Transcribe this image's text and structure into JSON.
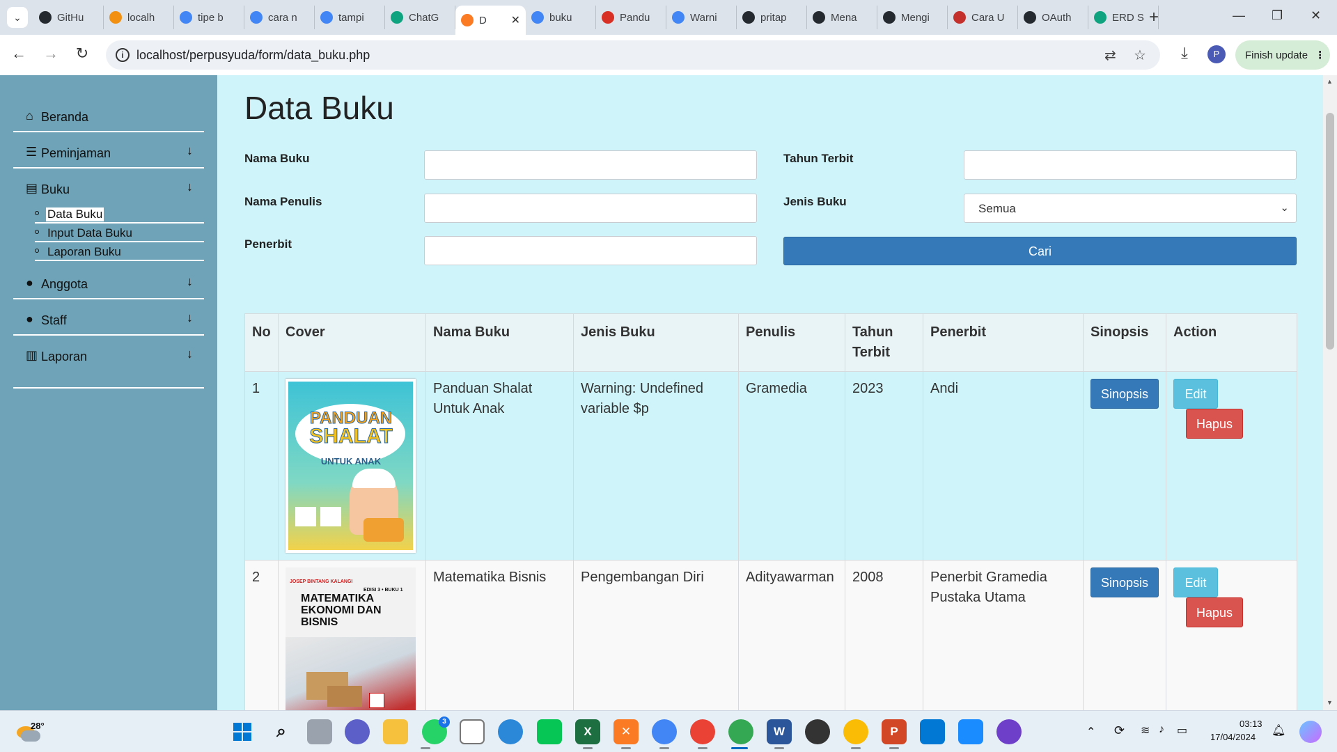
{
  "browser": {
    "tabs": [
      {
        "title": "GitHu",
        "icon": "github-icon",
        "color": "#24292f"
      },
      {
        "title": "localh",
        "icon": "phpmyadmin-icon",
        "color": "#f29111"
      },
      {
        "title": "tipe b",
        "icon": "google-icon",
        "color": "#4285f4"
      },
      {
        "title": "cara n",
        "icon": "google-icon",
        "color": "#4285f4"
      },
      {
        "title": "tampi",
        "icon": "google-icon",
        "color": "#4285f4"
      },
      {
        "title": "ChatG",
        "icon": "chatgpt-icon",
        "color": "#10a37f"
      },
      {
        "title": "D",
        "icon": "xampp-icon",
        "color": "#fb7a24",
        "active": true
      },
      {
        "title": "buku",
        "icon": "google-icon",
        "color": "#4285f4"
      },
      {
        "title": "Pandu",
        "icon": "bookmark-icon",
        "color": "#d93025"
      },
      {
        "title": "Warni",
        "icon": "google-icon",
        "color": "#4285f4"
      },
      {
        "title": "pritap",
        "icon": "github-icon",
        "color": "#24292f"
      },
      {
        "title": "Mena",
        "icon": "github-icon",
        "color": "#24292f"
      },
      {
        "title": "Mengi",
        "icon": "github-icon",
        "color": "#24292f"
      },
      {
        "title": "Cara U",
        "icon": "magnet-icon",
        "color": "#c4302b"
      },
      {
        "title": "OAuth",
        "icon": "github-icon",
        "color": "#24292f"
      },
      {
        "title": "ERD S",
        "icon": "chatgpt-icon",
        "color": "#10a37f"
      }
    ],
    "url": "localhost/perpusyuda/form/data_buku.php",
    "profile_initial": "P",
    "finish_update": "Finish update"
  },
  "sidebar": {
    "items": [
      {
        "label": "Beranda",
        "icon": "home-icon"
      },
      {
        "label": "Peminjaman",
        "icon": "list-icon"
      },
      {
        "label": "Buku",
        "icon": "book-icon"
      },
      {
        "label": "Anggota",
        "icon": "user-icon"
      },
      {
        "label": "Staff",
        "icon": "user-icon"
      },
      {
        "label": "Laporan",
        "icon": "bar-chart-icon"
      }
    ],
    "buku_submenu": [
      "Data Buku",
      "Input Data Buku",
      "Laporan Buku"
    ]
  },
  "page": {
    "title": "Data Buku",
    "form": {
      "nama_buku_label": "Nama Buku",
      "nama_penulis_label": "Nama Penulis",
      "penerbit_label": "Penerbit",
      "tahun_terbit_label": "Tahun Terbit",
      "jenis_buku_label": "Jenis Buku",
      "jenis_buku_value": "Semua",
      "cari_label": "Cari"
    },
    "table": {
      "headers": [
        "No",
        "Cover",
        "Nama Buku",
        "Jenis Buku",
        "Penulis",
        "Tahun Terbit",
        "Penerbit",
        "Sinopsis",
        "Action"
      ],
      "rows": [
        {
          "no": "1",
          "cover_title_1": "PANDUAN",
          "cover_title_2": "SHALAT",
          "cover_subtitle": "UNTUK ANAK",
          "nama_buku": "Panduan Shalat Untuk Anak",
          "jenis_buku": "Warning: Undefined variable $p",
          "penulis": "Gramedia",
          "tahun_terbit": "2023",
          "penerbit": "Andi"
        },
        {
          "no": "2",
          "cover_author": "JOSEP BINTANG KALANGI",
          "cover_edition": "EDISI 3 • BUKU 1",
          "cover_title": "MATEMATIKA EKONOMI DAN BISNIS",
          "nama_buku": "Matematika Bisnis",
          "jenis_buku": "Pengembangan Diri",
          "penulis": "Adityawarman",
          "tahun_terbit": "2008",
          "penerbit": "Penerbit Gramedia Pustaka Utama"
        }
      ],
      "sinopsis_label": "Sinopsis",
      "edit_label": "Edit",
      "hapus_label": "Hapus"
    }
  },
  "taskbar": {
    "weather_temp": "28°",
    "time": "03:13",
    "date": "17/04/2024",
    "whatsapp_badge": "3"
  }
}
